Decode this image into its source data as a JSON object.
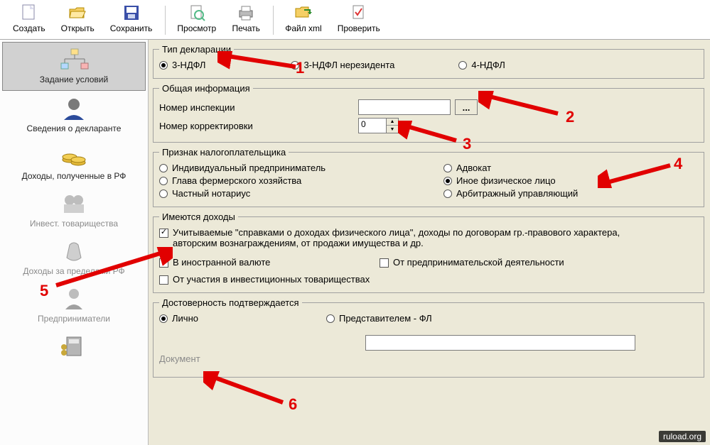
{
  "toolbar": {
    "items": [
      {
        "label": "Создать"
      },
      {
        "label": "Открыть"
      },
      {
        "label": "Сохранить"
      },
      {
        "label": "Просмотр"
      },
      {
        "label": "Печать"
      },
      {
        "label": "Файл xml"
      },
      {
        "label": "Проверить"
      }
    ]
  },
  "sidebar": {
    "items": [
      {
        "label": "Задание условий",
        "selected": true,
        "disabled": false
      },
      {
        "label": "Сведения о декларанте",
        "disabled": false
      },
      {
        "label": "Доходы, полученные в РФ",
        "disabled": false
      },
      {
        "label": "Инвест. товарищества",
        "disabled": true
      },
      {
        "label": "Доходы за пределами РФ",
        "disabled": true
      },
      {
        "label": "Предприниматели",
        "disabled": true
      },
      {
        "label": "",
        "disabled": true
      }
    ]
  },
  "groups": {
    "decl_type": {
      "legend": "Тип декларации",
      "opts": [
        "3-НДФЛ",
        "3-НДФЛ нерезидента",
        "4-НДФЛ"
      ],
      "selected": 0
    },
    "general": {
      "legend": "Общая информация",
      "inspection_label": "Номер инспекции",
      "correction_label": "Номер корректировки",
      "correction_value": "0",
      "ellipsis": "..."
    },
    "taxpayer": {
      "legend": "Признак налогоплательщика",
      "left": [
        "Индивидуальный предприниматель",
        "Глава фермерского хозяйства",
        "Частный нотариус"
      ],
      "right": [
        "Адвокат",
        "Иное физическое лицо",
        "Арбитражный управляющий"
      ],
      "selected": "Иное физическое лицо"
    },
    "incomes": {
      "legend": "Имеются доходы",
      "chk1": "Учитываемые \"справками о доходах физического лица\", доходы по договорам гр.-правового характера, авторским вознаграждениям, от продажи имущества и др.",
      "chk2": "В иностранной валюте",
      "chk3": "От предпринимательской деятельности",
      "chk4": "От участия в инвестиционных товариществах"
    },
    "confirm": {
      "legend": "Достоверность подтверждается",
      "opt1": "Лично",
      "opt2": "Представителем - ФЛ",
      "doc_label": "Документ"
    }
  },
  "annotations": {
    "nums": [
      "1",
      "2",
      "3",
      "4",
      "5",
      "6"
    ]
  },
  "watermark": "ruload.org"
}
